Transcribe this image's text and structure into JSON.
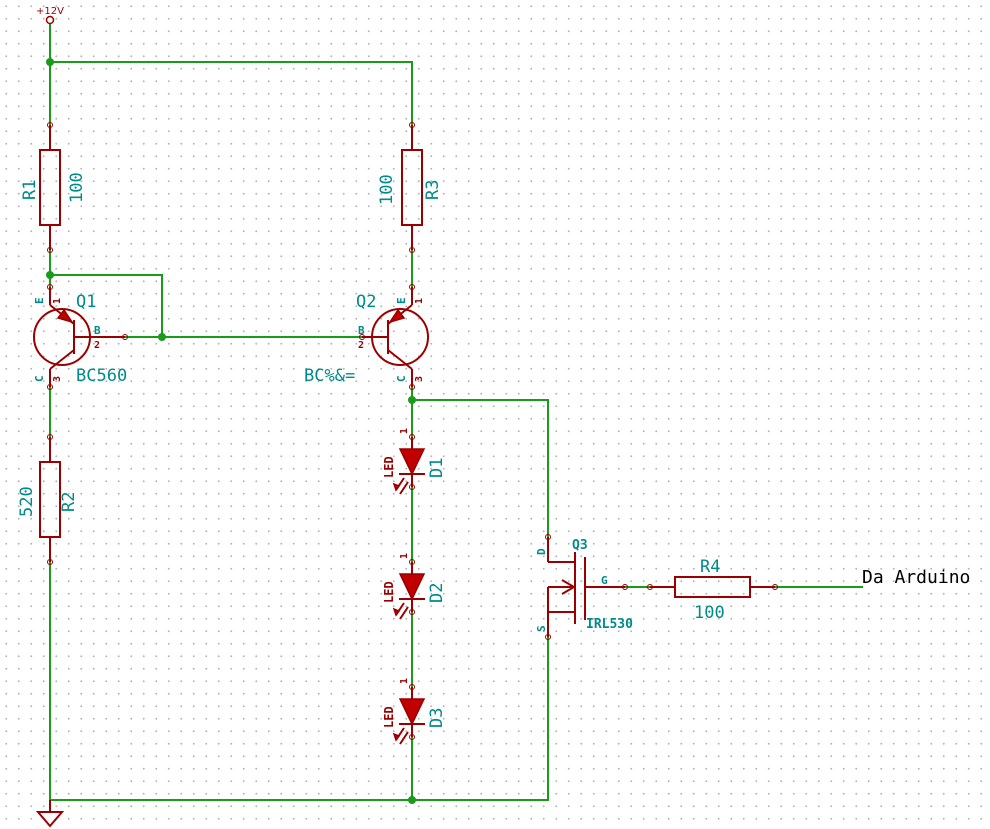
{
  "power": {
    "label": "+12V"
  },
  "resistors": {
    "r1": {
      "ref": "R1",
      "value": "100"
    },
    "r2": {
      "ref": "R2",
      "value": "520"
    },
    "r3": {
      "ref": "R3",
      "value": "100"
    },
    "r4": {
      "ref": "R4",
      "value": "100"
    }
  },
  "transistors": {
    "q1": {
      "ref": "Q1",
      "value": "BC560",
      "pins": {
        "e": "E",
        "b": "B",
        "c": "C",
        "e_num": "1",
        "b_num": "2",
        "c_num": "3"
      }
    },
    "q2": {
      "ref": "Q2",
      "value": "BC%&=",
      "pins": {
        "e": "E",
        "b": "B",
        "c": "C",
        "e_num": "1",
        "b_num": "2",
        "c_num": "3"
      }
    },
    "q3": {
      "ref": "Q3",
      "value": "IRL530",
      "pins": {
        "d": "D",
        "g": "G",
        "s": "S"
      }
    }
  },
  "leds": {
    "d1": {
      "ref": "D1",
      "value": "LED",
      "pin": "1"
    },
    "d2": {
      "ref": "D2",
      "value": "LED",
      "pin": "1"
    },
    "d3": {
      "ref": "D3",
      "value": "LED",
      "pin": "1"
    }
  },
  "net_label": "Da Arduino",
  "colors": {
    "wire": "#1a9b1a",
    "component": "#9b0000",
    "text": "#008b8b",
    "grid": "#b4b4b4"
  }
}
